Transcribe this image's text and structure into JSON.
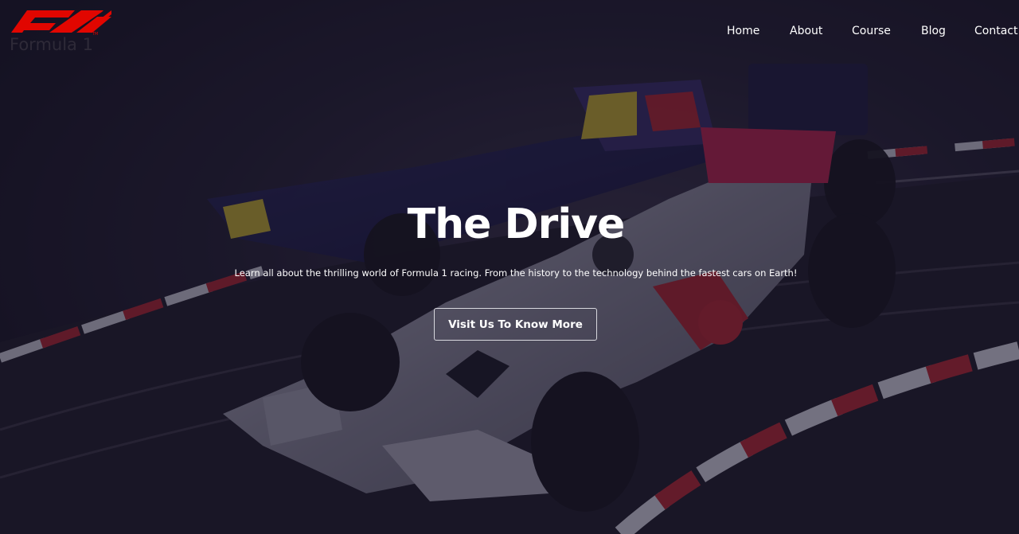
{
  "brand": {
    "logo_text": "Formula 1",
    "accent": "#e10600"
  },
  "nav": {
    "items": [
      {
        "label": "Home"
      },
      {
        "label": "About"
      },
      {
        "label": "Course"
      },
      {
        "label": "Blog"
      },
      {
        "label": "Contact"
      }
    ]
  },
  "hero": {
    "title": "The Drive",
    "subtitle": "Learn all about the thrilling world of Formula 1 racing. From the history to the technology behind the fastest cars on Earth!",
    "cta_label": "Visit Us To Know More",
    "background_image": "f1-toy-cars-on-slot-track"
  },
  "colors": {
    "overlay": "#161228",
    "text": "#ffffff",
    "track_red": "#b8242b"
  }
}
